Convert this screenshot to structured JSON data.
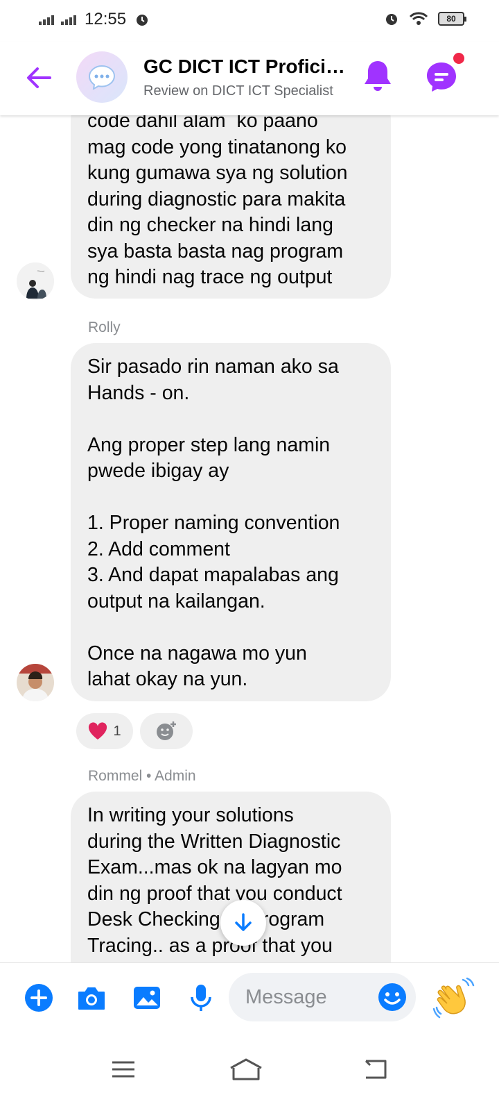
{
  "status_bar": {
    "time": "12:55",
    "battery": "80",
    "icons": [
      "signal-icon",
      "alarm-icon",
      "wifi-icon",
      "battery-icon"
    ]
  },
  "header": {
    "title": "GC DICT ICT Proficiency",
    "subtitle": "Review on DICT ICT Specialist",
    "icons": [
      "back-arrow-icon",
      "chat-bubble-icon",
      "bell-icon",
      "threads-icon"
    ],
    "accent_color": "#a033ff"
  },
  "messages": [
    {
      "sender": "",
      "text": "code dahil alam  ko paano\nmag code yong tinatanong ko\nkung gumawa sya ng solution\nduring diagnostic para makita\ndin ng checker na hindi lang\nsya basta basta nag program\nng hindi nag trace ng output"
    },
    {
      "sender": "Rolly",
      "text": "Sir pasado rin naman ako sa\nHands - on.\n\nAng proper step lang namin\npwede ibigay ay\n\n1. Proper naming convention\n2. Add comment\n3. And dapat mapalabas ang\noutput na kailangan.\n\nOnce na nagawa mo yun\nlahat okay na yun.",
      "reaction": {
        "emoji": "heart",
        "count": "1"
      }
    },
    {
      "sender": "Rommel • Admin",
      "text": "In writing your solutions\nduring the Written Diagnostic\nExam...mas ok na lagyan mo\ndin ng proof that you conduct\nDesk Checking or Program\nTracing.. as a proof that you"
    }
  ],
  "composer": {
    "placeholder": "Message",
    "icons": [
      "plus-icon",
      "camera-icon",
      "gallery-icon",
      "microphone-icon",
      "emoji-icon",
      "wave-hand-icon"
    ],
    "accent_color": "#0a7cff"
  },
  "navbar": {
    "icons": [
      "menu-icon",
      "home-icon",
      "back-icon"
    ]
  }
}
